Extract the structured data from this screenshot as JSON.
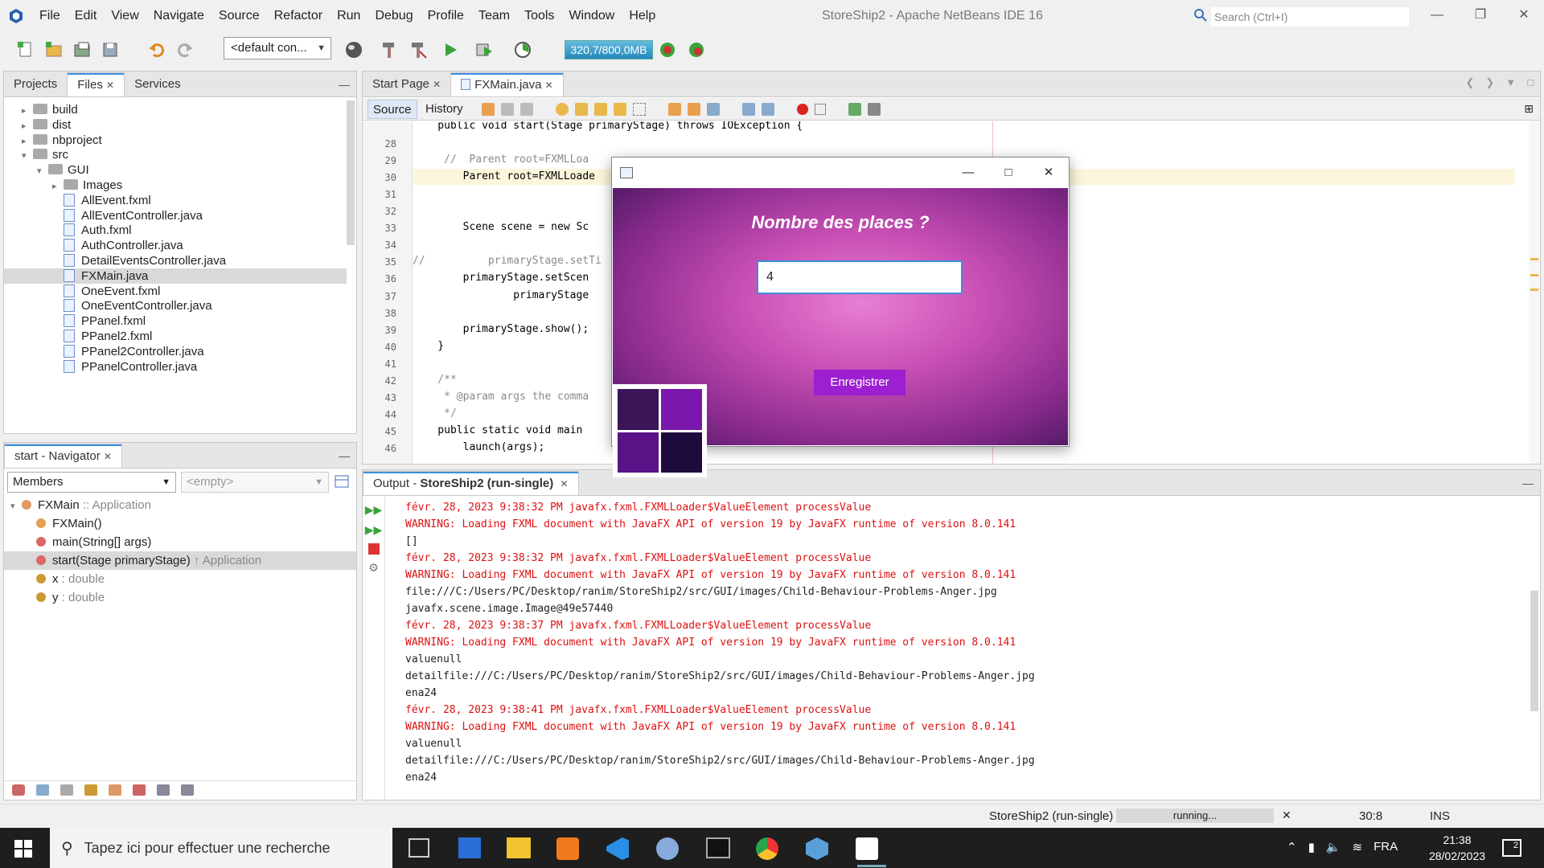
{
  "window": {
    "title": "StoreShip2 - Apache NetBeans IDE 16",
    "search_placeholder": "Search (Ctrl+I)"
  },
  "menu": [
    "File",
    "Edit",
    "View",
    "Navigate",
    "Source",
    "Refactor",
    "Run",
    "Debug",
    "Profile",
    "Team",
    "Tools",
    "Window",
    "Help"
  ],
  "toolbar": {
    "config": "<default con...",
    "memory": "320,7/800,0MB"
  },
  "projects_panel": {
    "tabs": [
      "Projects",
      "Files",
      "Services"
    ],
    "tree": [
      {
        "label": "build",
        "type": "folder",
        "depth": 1,
        "expander": "closed"
      },
      {
        "label": "dist",
        "type": "folder",
        "depth": 1,
        "expander": "closed"
      },
      {
        "label": "nbproject",
        "type": "folder",
        "depth": 1,
        "expander": "closed"
      },
      {
        "label": "src",
        "type": "folder",
        "depth": 1,
        "expander": "open"
      },
      {
        "label": "GUI",
        "type": "folder",
        "depth": 2,
        "expander": "open"
      },
      {
        "label": "Images",
        "type": "folder",
        "depth": 3,
        "expander": "closed"
      },
      {
        "label": "AllEvent.fxml",
        "type": "file",
        "depth": 3
      },
      {
        "label": "AllEventController.java",
        "type": "file",
        "depth": 3
      },
      {
        "label": "Auth.fxml",
        "type": "file",
        "depth": 3
      },
      {
        "label": "AuthController.java",
        "type": "file",
        "depth": 3
      },
      {
        "label": "DetailEventsController.java",
        "type": "file",
        "depth": 3
      },
      {
        "label": "FXMain.java",
        "type": "file",
        "depth": 3,
        "selected": true
      },
      {
        "label": "OneEvent.fxml",
        "type": "file",
        "depth": 3
      },
      {
        "label": "OneEventController.java",
        "type": "file",
        "depth": 3
      },
      {
        "label": "PPanel.fxml",
        "type": "file",
        "depth": 3
      },
      {
        "label": "PPanel2.fxml",
        "type": "file",
        "depth": 3
      },
      {
        "label": "PPanel2Controller.java",
        "type": "file",
        "depth": 3
      },
      {
        "label": "PPanelController.java",
        "type": "file",
        "depth": 3
      }
    ]
  },
  "navigator": {
    "tab": "start - Navigator",
    "members_select": "Members",
    "filter_select": "<empty>",
    "items": [
      {
        "label": "FXMain",
        "suffix": " :: Application"
      },
      {
        "label": "FXMain()",
        "suffix": ""
      },
      {
        "label": "main(String[] args)",
        "suffix": ""
      },
      {
        "label": "start(Stage primaryStage)",
        "suffix": " ↑ Application",
        "selected": true
      },
      {
        "label": "x",
        "suffix": " : double"
      },
      {
        "label": "y",
        "suffix": " : double"
      }
    ]
  },
  "editor": {
    "tabs": [
      "Start Page",
      "FXMain.java"
    ],
    "subtabs": [
      "Source",
      "History"
    ],
    "lines": [
      {
        "n": "",
        "text": "    public void start(Stage primaryStage) throws IOException {"
      },
      {
        "n": "28",
        "text": ""
      },
      {
        "n": "29",
        "text": "     //  Parent root=FXMLLoa"
      },
      {
        "n": "30",
        "text": "        Parent root=FXMLLoade"
      },
      {
        "n": "31",
        "text": ""
      },
      {
        "n": "32",
        "text": ""
      },
      {
        "n": "33",
        "text": "        Scene scene = new Sc"
      },
      {
        "n": "34",
        "text": ""
      },
      {
        "n": "35",
        "text": "//          primaryStage.setTi"
      },
      {
        "n": "36",
        "text": "        primaryStage.setScen"
      },
      {
        "n": "37",
        "text": "                primaryStage"
      },
      {
        "n": "38",
        "text": ""
      },
      {
        "n": "39",
        "text": "        primaryStage.show();"
      },
      {
        "n": "40",
        "text": "    }"
      },
      {
        "n": "41",
        "text": ""
      },
      {
        "n": "42",
        "text": "    /**"
      },
      {
        "n": "43",
        "text": "     * @param args the comma"
      },
      {
        "n": "44",
        "text": "     */"
      },
      {
        "n": "45",
        "text": "    public static void main"
      },
      {
        "n": "46",
        "text": "        launch(args);"
      }
    ]
  },
  "output": {
    "tab_prefix": "Output - ",
    "tab_name": "StoreShip2 (run-single)",
    "lines": [
      {
        "text": "févr. 28, 2023 9:38:32 PM javafx.fxml.FXMLLoader$ValueElement processValue",
        "err": true
      },
      {
        "text": "WARNING: Loading FXML document with JavaFX API of version 19 by JavaFX runtime of version 8.0.141",
        "err": true
      },
      {
        "text": "[]",
        "err": false
      },
      {
        "text": "févr. 28, 2023 9:38:32 PM javafx.fxml.FXMLLoader$ValueElement processValue",
        "err": true
      },
      {
        "text": "WARNING: Loading FXML document with JavaFX API of version 19 by JavaFX runtime of version 8.0.141",
        "err": true
      },
      {
        "text": "file:///C:/Users/PC/Desktop/ranim/StoreShip2/src/GUI/images/Child-Behaviour-Problems-Anger.jpg",
        "err": false
      },
      {
        "text": "javafx.scene.image.Image@49e57440",
        "err": false
      },
      {
        "text": "févr. 28, 2023 9:38:37 PM javafx.fxml.FXMLLoader$ValueElement processValue",
        "err": true
      },
      {
        "text": "WARNING: Loading FXML document with JavaFX API of version 19 by JavaFX runtime of version 8.0.141",
        "err": true
      },
      {
        "text": "valuenull",
        "err": false
      },
      {
        "text": "detailfile:///C:/Users/PC/Desktop/ranim/StoreShip2/src/GUI/images/Child-Behaviour-Problems-Anger.jpg",
        "err": false
      },
      {
        "text": "ena24",
        "err": false
      },
      {
        "text": "févr. 28, 2023 9:38:41 PM javafx.fxml.FXMLLoader$ValueElement processValue",
        "err": true
      },
      {
        "text": "WARNING: Loading FXML document with JavaFX API of version 19 by JavaFX runtime of version 8.0.141",
        "err": true
      },
      {
        "text": "valuenull",
        "err": false
      },
      {
        "text": "detailfile:///C:/Users/PC/Desktop/ranim/StoreShip2/src/GUI/images/Child-Behaviour-Problems-Anger.jpg",
        "err": false
      },
      {
        "text": "ena24",
        "err": false
      }
    ]
  },
  "statusbar": {
    "project": "StoreShip2 (run-single)",
    "progress": "running...",
    "position": "30:8",
    "mode": "INS"
  },
  "dialog": {
    "title_text": "Nombre des places ?",
    "input_value": "4",
    "button_label": "Enregistrer"
  },
  "taskbar": {
    "search_placeholder": "Tapez ici pour effectuer une recherche",
    "lang": "FRA",
    "time": "21:38",
    "date": "28/02/2023",
    "notifications": "2"
  }
}
